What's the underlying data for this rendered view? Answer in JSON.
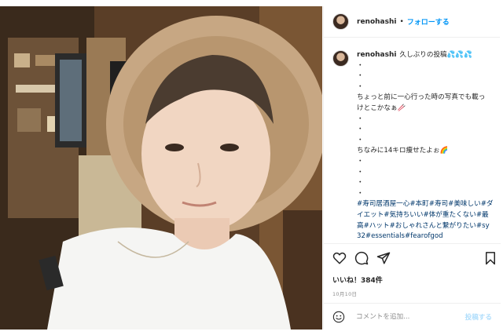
{
  "header": {
    "username": "renohashi",
    "separator": "•",
    "follow_label": "フォローする"
  },
  "caption": {
    "username": "renohashi",
    "lines": [
      "久しぶりの投稿💦💦💦",
      "・",
      "・",
      "・",
      "ちょっと前に一心行った時の写真でも載っ",
      "けとこかなぁ🥢",
      "・",
      "・",
      "・",
      "ちなみに14キロ痩せたよぉ🌈",
      "・",
      "・",
      "・",
      "・"
    ],
    "hashtags": "#寿司居酒屋一心#本町#寿司#美味しい#ダイエット#気持ちいい#体が重たくない#最高#ハット#おしゃれさんと繋がりたい#sy32#essentials#fearofgod"
  },
  "actions": {
    "like_icon": "heart-icon",
    "comment_icon": "comment-icon",
    "share_icon": "share-icon",
    "save_icon": "bookmark-icon"
  },
  "likes": "いいね！384件",
  "date": "10月10日",
  "comment": {
    "placeholder": "コメントを追加...",
    "post_label": "投稿する",
    "emoji_icon": "emoji-icon"
  },
  "colors": {
    "link": "#0095f6",
    "hashtag": "#00376b",
    "muted": "#8e8e8e",
    "post_disabled": "#b2dffc"
  }
}
